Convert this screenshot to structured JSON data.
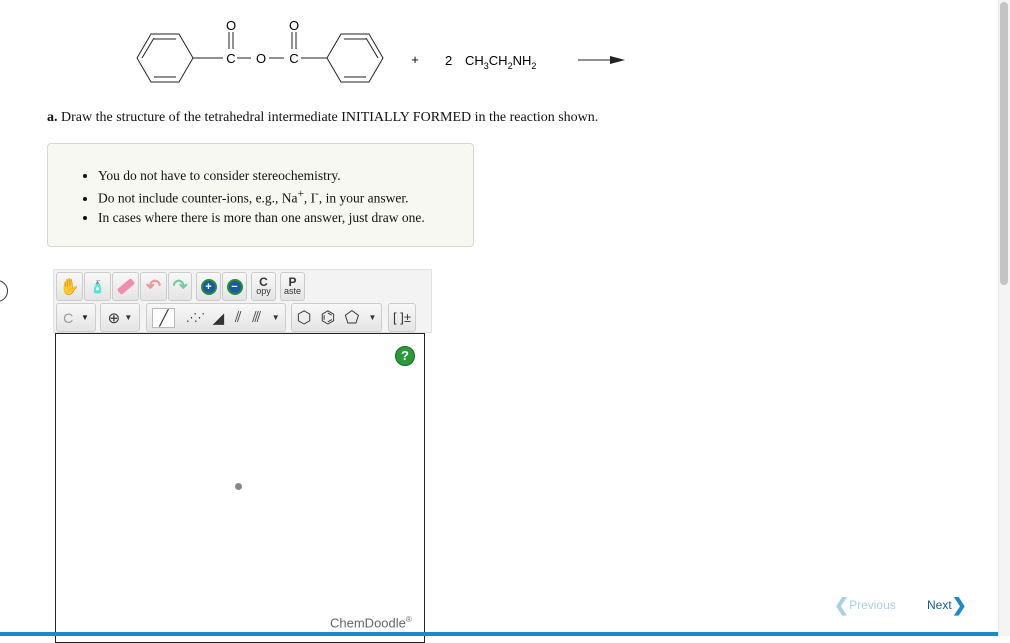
{
  "reaction": {
    "reagent_coefficient": "2",
    "reagent": "CH3CH2NH2",
    "plus": "+",
    "atom_labels": {
      "carbonyl_o": "O",
      "carbon": "C",
      "bridge_o": "O"
    }
  },
  "question": {
    "label": "a.",
    "text": "Draw the structure of the tetrahedral intermediate INITIALLY FORMED in the reaction shown."
  },
  "hints": [
    "You do not have to consider stereochemistry.",
    "Do not include counter-ions, e.g., Na+, I-, in your answer.",
    "In cases where there is more than one answer, just draw one."
  ],
  "toolbar": {
    "copy_label_top": "C",
    "copy_label_bottom": "opy",
    "paste_label_top": "P",
    "paste_label_bottom": "aste",
    "element_label": "C",
    "charge_label": "[ ]±"
  },
  "editor": {
    "help_label": "?",
    "brand": "ChemDoodle",
    "brand_mark": "®"
  },
  "nav": {
    "previous_label": "Previous",
    "next_label": "Next"
  },
  "colors": {
    "accent": "#1d8ac8",
    "help": "#2a9a3a"
  }
}
